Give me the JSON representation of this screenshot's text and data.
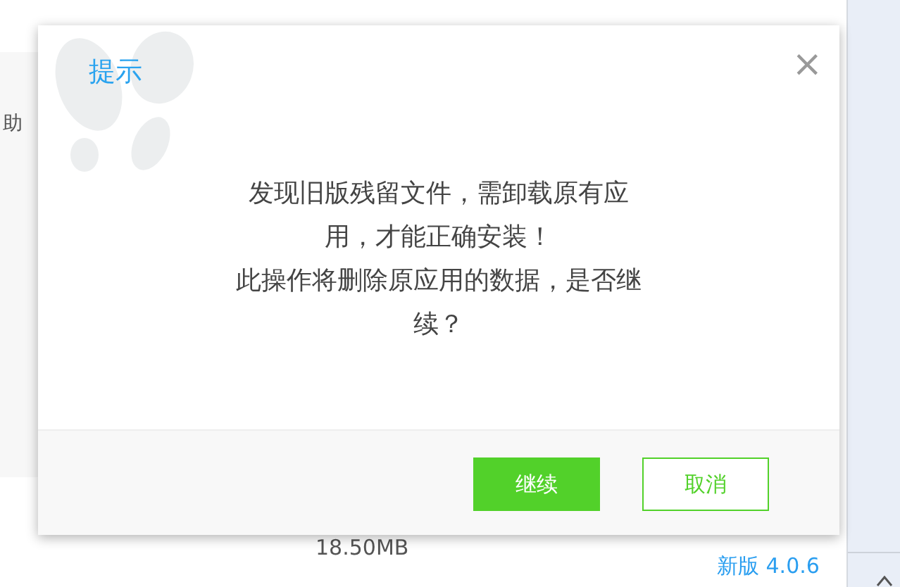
{
  "background": {
    "side_text": "助",
    "file_size": "18.50MB",
    "new_version_link": "新版 4.0.6"
  },
  "dialog": {
    "title": "提示",
    "close": "×",
    "message_lines": [
      "发现旧版残留文件，需卸载原有应",
      "用，才能正确安装！",
      "此操作将删除原应用的数据，是否继",
      "续？"
    ],
    "buttons": [
      {
        "label": "继续",
        "kind": "primary"
      },
      {
        "label": "取消",
        "kind": "secondary"
      }
    ]
  }
}
